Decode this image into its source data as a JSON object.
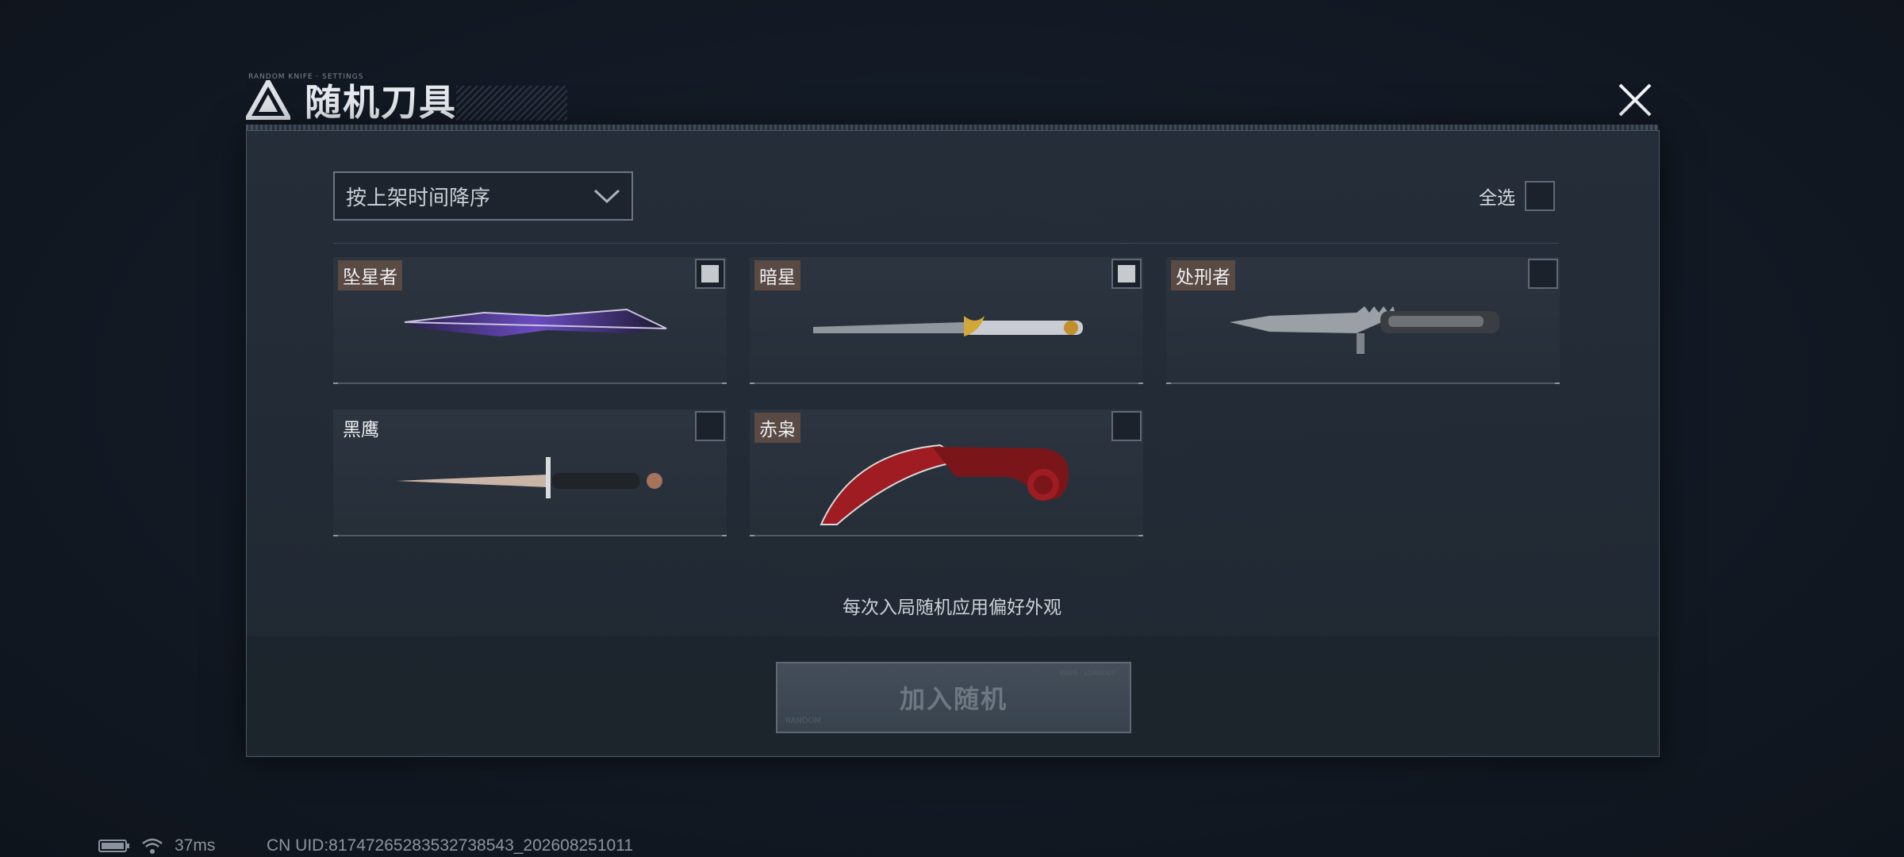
{
  "dialog": {
    "title": "随机刀具",
    "title_deco": "RANDOM KNIFE · SETTINGS",
    "sort": {
      "selected": "按上架时间降序"
    },
    "select_all_label": "全选",
    "knives": [
      {
        "name": "坠星者",
        "checked": true,
        "style": "purple-blade"
      },
      {
        "name": "暗星",
        "checked": true,
        "style": "silver-gold"
      },
      {
        "name": "处刑者",
        "checked": false,
        "style": "serrated-dark"
      },
      {
        "name": "黑鹰",
        "checked": false,
        "style": "dagger"
      },
      {
        "name": "赤枭",
        "checked": false,
        "style": "red-karambit"
      }
    ],
    "hint": "每次入局随机应用偏好外观",
    "join_button": "加入随机",
    "join_deco": "RANDOM",
    "join_deco2": "KNIFE · LOADOUT"
  },
  "status_bar": {
    "ping": "37ms",
    "uid": "CN UID:817472652835327385­43_202608251011"
  },
  "colors": {
    "accent": "#5a4a44",
    "panel": "#262e3a"
  }
}
